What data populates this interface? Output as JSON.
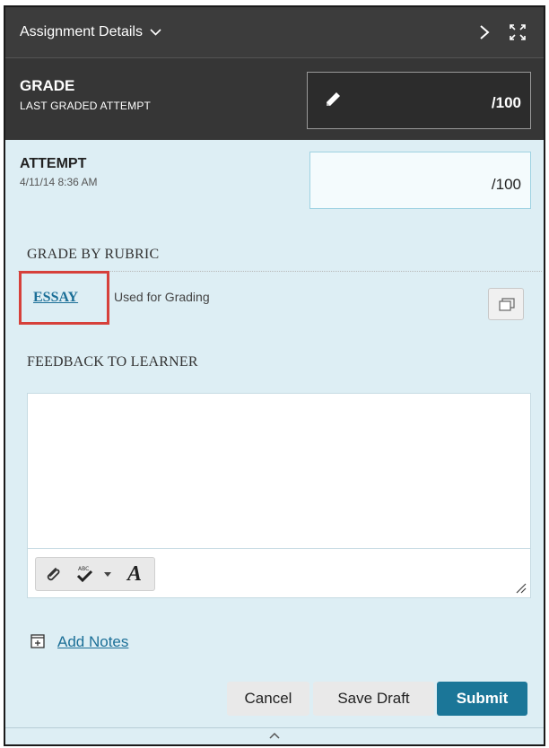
{
  "colors": {
    "header_bg": "#3c3c3c",
    "panel_bg": "#ddeef4",
    "link": "#1b6f97",
    "primary_button": "#1b7698",
    "highlight_border": "#d6403a"
  },
  "header": {
    "title": "Assignment Details",
    "title_icon": "chevron-down-icon",
    "next_icon": "chevron-right-icon",
    "expand_icon": "expand-icon"
  },
  "grade": {
    "title": "GRADE",
    "subtitle": "LAST GRADED ATTEMPT",
    "edit_icon": "pencil-icon",
    "out_of": "/100"
  },
  "attempt": {
    "title": "ATTEMPT",
    "date": "4/11/14 8:36 AM",
    "value": "",
    "out_of": "/100"
  },
  "rubric": {
    "heading": "GRADE BY RUBRIC",
    "name": "ESSAY",
    "status": "Used for Grading",
    "view_icon": "window-icon"
  },
  "feedback": {
    "heading": "FEEDBACK TO LEARNER",
    "text": "",
    "toolbar": {
      "attach_icon": "paperclip-icon",
      "spellcheck_icon": "spellcheck-icon",
      "dropdown_icon": "caret-down-icon",
      "format_label": "A"
    }
  },
  "notes": {
    "label": "Add Notes",
    "icon": "notes-icon"
  },
  "actions": {
    "cancel": "Cancel",
    "save_draft": "Save Draft",
    "submit": "Submit"
  },
  "footer": {
    "collapse_icon": "chevron-up-icon"
  }
}
